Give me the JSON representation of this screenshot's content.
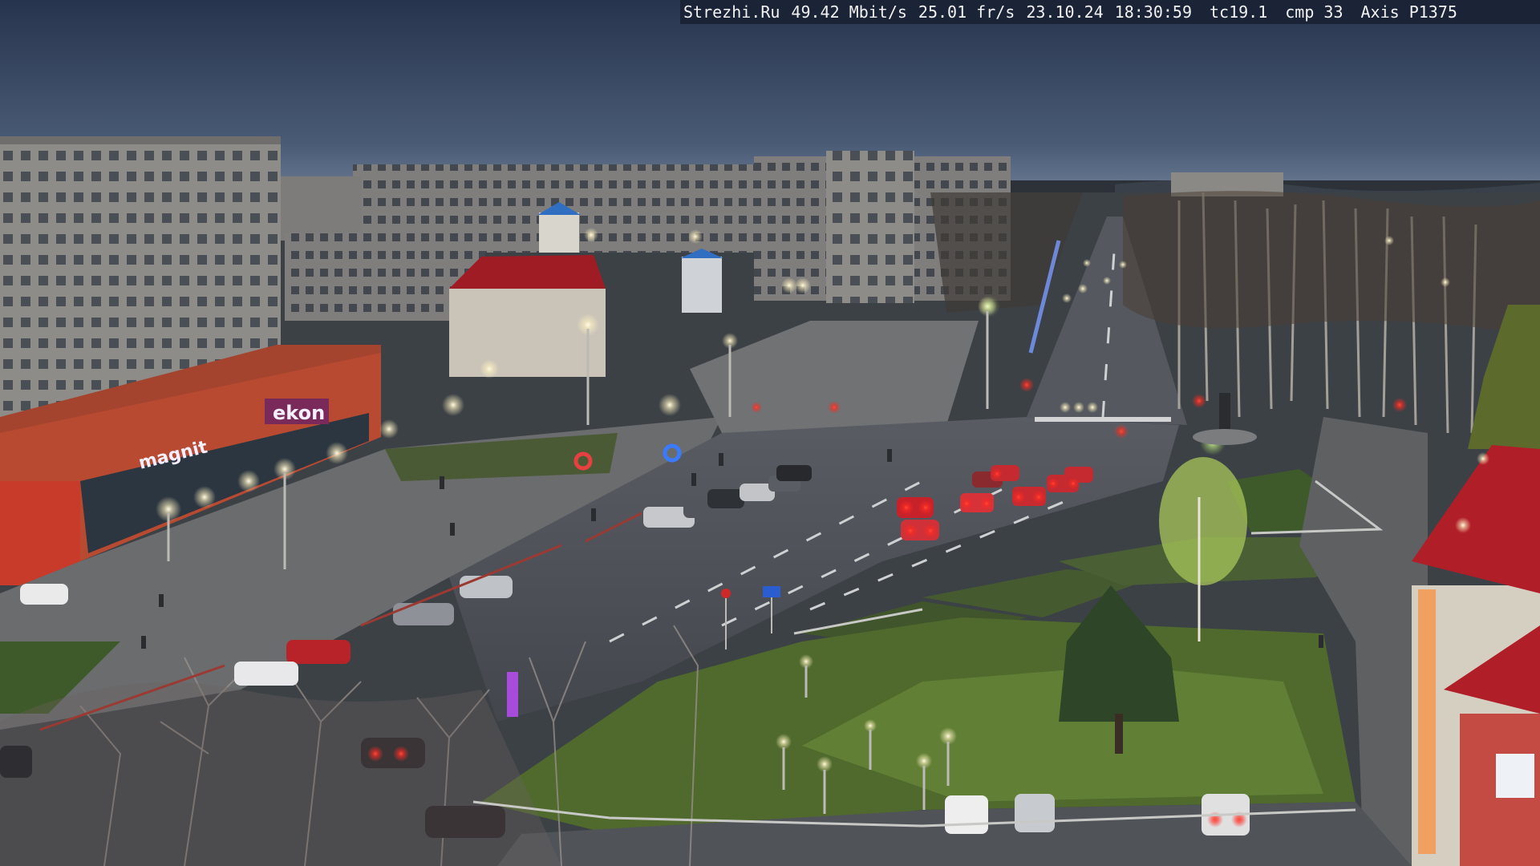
{
  "osd": {
    "site": "Strezhi.Ru",
    "bitrate": "49.42 Mbit/s",
    "framerate": "25.01 fr/s",
    "date": "23.10.24",
    "time": "18:30:59",
    "tc": "tc19.1",
    "cmp": "cmp 33",
    "camera": "Axis P1375"
  },
  "signs": {
    "store_left": "ekon",
    "store_lower": "magnit"
  },
  "colors": {
    "sky_top": "#2b3a55",
    "sky_horizon": "#5c6e88",
    "asphalt": "#4b4f55",
    "grass": "#3f5a2a",
    "building_brick": "#b84a32",
    "building_panel": "#8b8a88",
    "tail_light": "#ff2a20",
    "street_lamp": "#fff6d8",
    "roof_red": "#a01c24"
  }
}
